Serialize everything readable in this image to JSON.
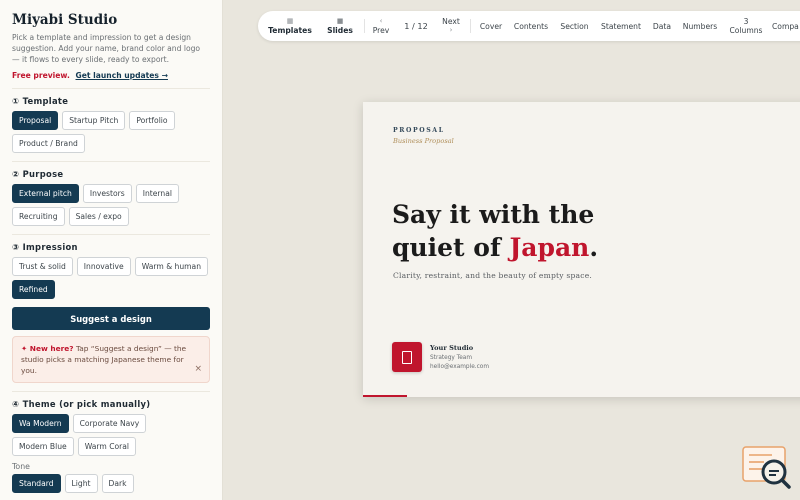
{
  "sidebar": {
    "title": "Miyabi Studio",
    "intro": "Pick a template and impression to get a design suggestion. Add your name, brand color and logo — it flows to every slide, ready to export.",
    "free_preview": "Free preview.",
    "launch_link": "Get launch updates →",
    "template": {
      "title": "① Template",
      "options": [
        "Proposal",
        "Startup Pitch",
        "Portfolio",
        "Product / Brand"
      ],
      "selected": "Proposal"
    },
    "purpose": {
      "title": "② Purpose",
      "options": [
        "External pitch",
        "Investors",
        "Internal",
        "Recruiting",
        "Sales / expo"
      ],
      "selected": "External pitch"
    },
    "impression": {
      "title": "③ Impression",
      "options": [
        "Trust & solid",
        "Innovative",
        "Warm & human",
        "Refined"
      ],
      "selected": "Refined"
    },
    "suggest_button": "Suggest a design",
    "notice": {
      "prefix": "✦ New here?",
      "text": " Tap “Suggest a design” — the studio picks a matching Japanese theme for you.",
      "close": "×"
    },
    "theme": {
      "title": "④ Theme (or pick manually)",
      "options": [
        "Wa Modern",
        "Corporate Navy",
        "Modern Blue",
        "Warm Coral"
      ],
      "selected": "Wa Modern"
    },
    "tone": {
      "label": "Tone",
      "options": [
        "Standard",
        "Light",
        "Dark"
      ],
      "selected": "Standard"
    }
  },
  "toolbar": {
    "templates": "Templates",
    "slides": "Slides",
    "prev": "Prev",
    "page": "1 / 12",
    "next": "Next",
    "layouts": [
      "Cover",
      "Contents",
      "Section",
      "Statement",
      "Data",
      "Numbers"
    ],
    "columns_count": "3",
    "columns_label": "Columns",
    "compare": "Compa"
  },
  "slide": {
    "label": "PROPOSAL",
    "sublabel": "Business Proposal",
    "headline_line1": "Say it with the",
    "headline_line2_pre": "quiet of ",
    "headline_accent": "Japan",
    "headline_end": ".",
    "tagline": "Clarity, restraint, and the beauty of empty space.",
    "studio": "Your Studio",
    "team": "Strategy Team",
    "email": "hello@example.com"
  },
  "colors": {
    "primary": "#143a52",
    "accent": "#c0152d",
    "background": "#e9e6dd"
  },
  "icons": {
    "help": "search-help-icon"
  }
}
